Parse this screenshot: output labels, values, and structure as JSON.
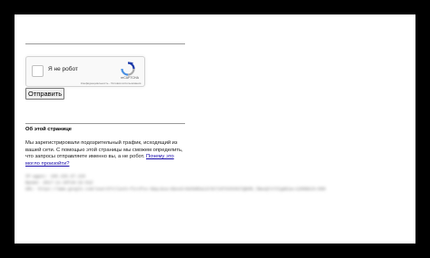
{
  "captcha": {
    "label": "Я не робот",
    "brand": "reCAPTCHA",
    "terms": "Конфиденциальность - Условия использования"
  },
  "form": {
    "submit_label": "Отправить"
  },
  "about": {
    "title": "Об этой странице",
    "text": "Мы зарегистрировали подозрительный трафик, исходящий из вашей сети. С помощью этой страницы мы сможем определить, что запросы отправляете именно вы, а не робот.",
    "link": "Почему это могло произойти?"
  },
  "blurred_info": {
    "ip_line": "IP-адрес: 195.155.67.225",
    "time_line": "Время: 2017-11-20T10:32:51Z",
    "url_line": "URL: https://www.google.com/search?client=firefox-b&q=&sa=X&ved=0ahUKEwi3r5C7z6TXAhVK3lQKHR_lBwsQ7xYIIg&biw=1280&bih=590"
  },
  "colors": {
    "frame": "#000000",
    "page": "#ffffff",
    "link": "#1a0dab",
    "recaptcha_blue": "#1c3aa9",
    "recaptcha_light_blue": "#4a90e2",
    "recaptcha_gray": "#aaaaaa"
  }
}
